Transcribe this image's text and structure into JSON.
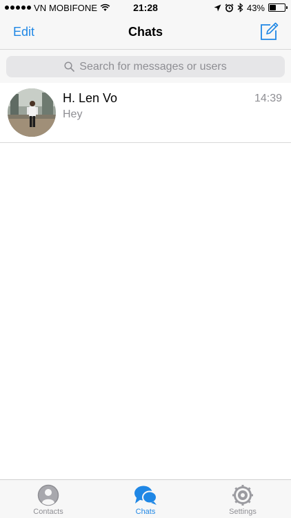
{
  "status_bar": {
    "carrier": "VN MOBIFONE",
    "time": "21:28",
    "battery_percent": "43%",
    "battery_level": 0.43
  },
  "nav": {
    "edit_label": "Edit",
    "title": "Chats",
    "compose_icon": "compose-icon"
  },
  "search": {
    "placeholder": "Search for messages or users"
  },
  "chats": [
    {
      "name": "H. Len Vo",
      "preview": "Hey",
      "time": "14:39"
    }
  ],
  "tabs": [
    {
      "label": "Contacts",
      "icon": "contacts-icon",
      "active": false
    },
    {
      "label": "Chats",
      "icon": "chats-icon",
      "active": true
    },
    {
      "label": "Settings",
      "icon": "settings-icon",
      "active": false
    }
  ],
  "colors": {
    "accent": "#1f87e5",
    "secondary_text": "#8e8e93",
    "bar_background": "#f7f7f7"
  }
}
